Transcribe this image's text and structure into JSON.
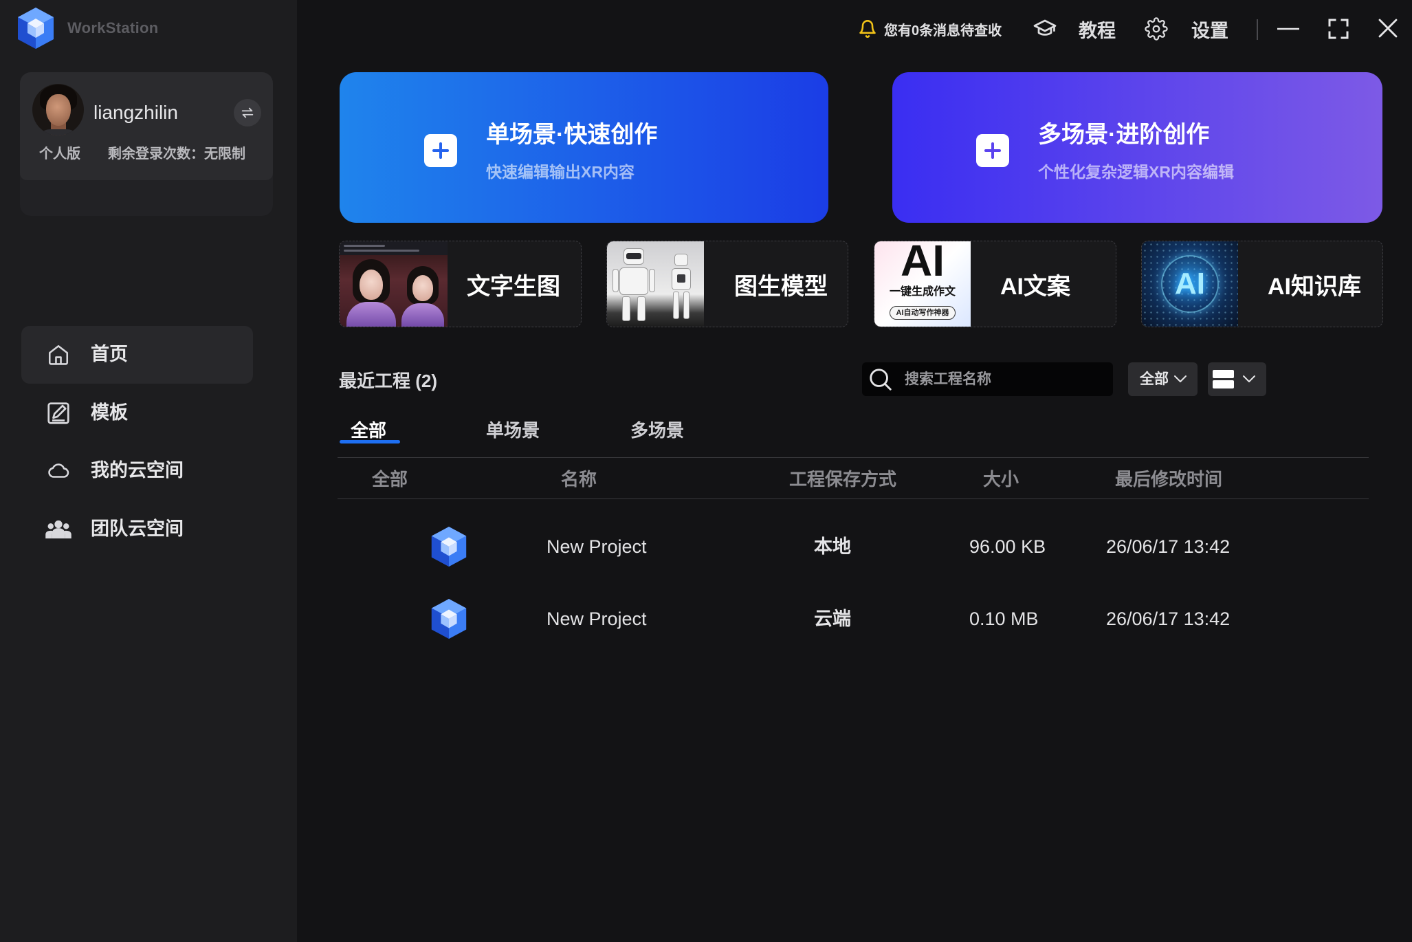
{
  "app": {
    "title": "WorkStation"
  },
  "user": {
    "name": "liangzhilin",
    "edition": "个人版",
    "login_remaining": "剩余登录次数：无限制"
  },
  "nav": [
    {
      "label": "首页",
      "icon": "home-icon",
      "active": true
    },
    {
      "label": "模板",
      "icon": "template-edit-icon",
      "active": false
    },
    {
      "label": "我的云空间",
      "icon": "cloud-icon",
      "active": false
    },
    {
      "label": "团队云空间",
      "icon": "team-icon",
      "active": false
    }
  ],
  "topbar": {
    "notification": "您有0条消息待查收",
    "tutorial": "教程",
    "settings": "设置"
  },
  "hero": [
    {
      "title": "单场景·快速创作",
      "subtitle": "快速编辑输出XR内容",
      "gradient": [
        "#1f84ec",
        "#1b3de6"
      ]
    },
    {
      "title": "多场景·进阶创作",
      "subtitle": "个性化复杂逻辑XR内容编辑",
      "gradient": [
        "#3a2ef2",
        "#7d5ae6"
      ]
    }
  ],
  "features": [
    {
      "label": "文字生图"
    },
    {
      "label": "图生模型"
    },
    {
      "label": "AI文案",
      "thumb": {
        "big": "AI",
        "line": "一键生成作文",
        "badge": "AI自动写作神器"
      }
    },
    {
      "label": "AI知识库",
      "thumb": {
        "big": "AI"
      }
    }
  ],
  "recent": {
    "title": "最近工程 (2)",
    "search_placeholder": "搜索工程名称",
    "filter": "全部",
    "tabs": [
      {
        "label": "全部",
        "active": true
      },
      {
        "label": "单场景",
        "active": false
      },
      {
        "label": "多场景",
        "active": false
      }
    ],
    "columns": [
      "全部",
      "名称",
      "工程保存方式",
      "大小",
      "最后修改时间"
    ],
    "rows": [
      {
        "name": "New Project",
        "storage": "本地",
        "size": "96.00 KB",
        "modified": "26/06/17 13:42"
      },
      {
        "name": "New Project",
        "storage": "云端",
        "size": "0.10 MB",
        "modified": "26/06/17 13:42"
      }
    ]
  },
  "colors": {
    "accent": "#1e6ff2",
    "bell": "#f2c318",
    "sidebar_bg": "#1d1d1f",
    "main_bg": "#131315"
  }
}
